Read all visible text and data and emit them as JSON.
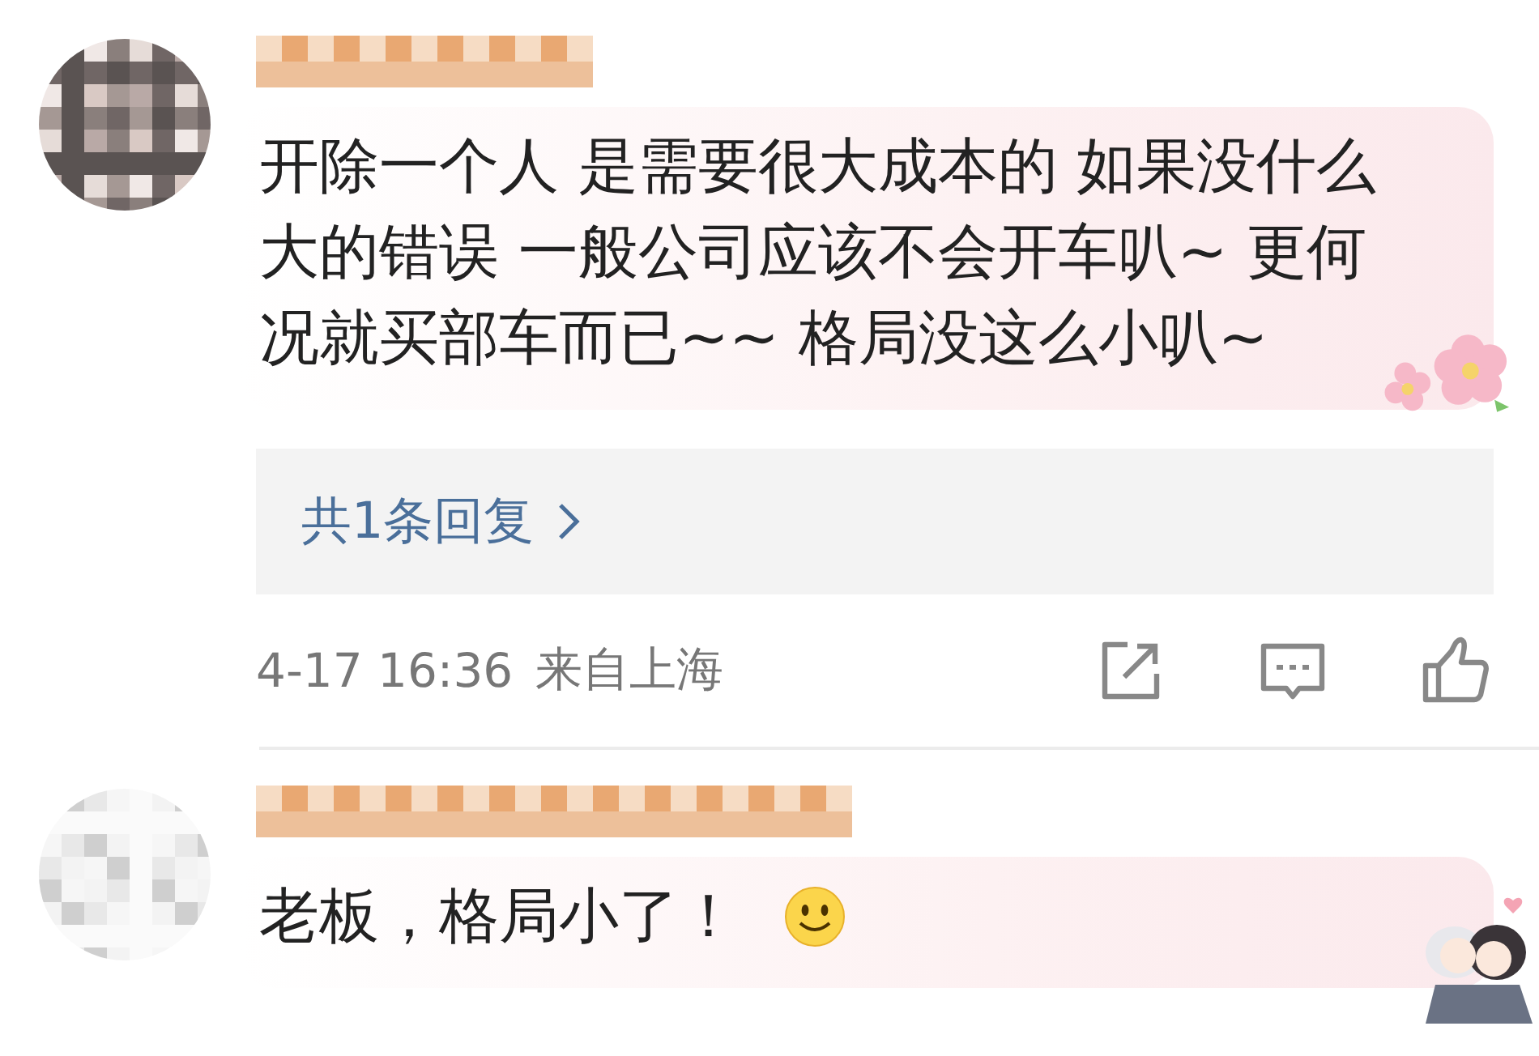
{
  "comments": [
    {
      "text": "开除一个人 是需要很大成本的 如果没什么大的错误 一般公司应该不会开车叭~ 更何况就买部车而已~~ 格局没这么小叭~",
      "decoration": {
        "kind": "flowers"
      },
      "reply_count": "共1条回复",
      "time": "4-17 16:36",
      "location": "来自上海"
    },
    {
      "text": "老板，格局小了！",
      "emoji": {
        "kind": "smile"
      },
      "decoration": {
        "kind": "figures"
      }
    }
  ]
}
